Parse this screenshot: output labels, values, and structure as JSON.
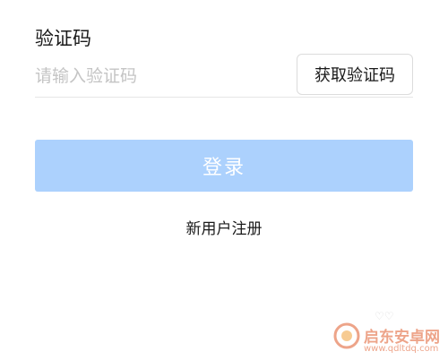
{
  "form": {
    "code_label": "验证码",
    "code_placeholder": "请输入验证码",
    "code_value": "",
    "get_code_label": "获取验证码",
    "login_label": "登录",
    "register_label": "新用户注册"
  },
  "colors": {
    "login_button_bg": "#acd1fd",
    "login_button_text": "#ffffff",
    "watermark": "#e05a2a"
  },
  "watermark": {
    "title": "启东安卓网",
    "url": "www.qdltdq.com",
    "icon": "watermark-logo-icon"
  }
}
